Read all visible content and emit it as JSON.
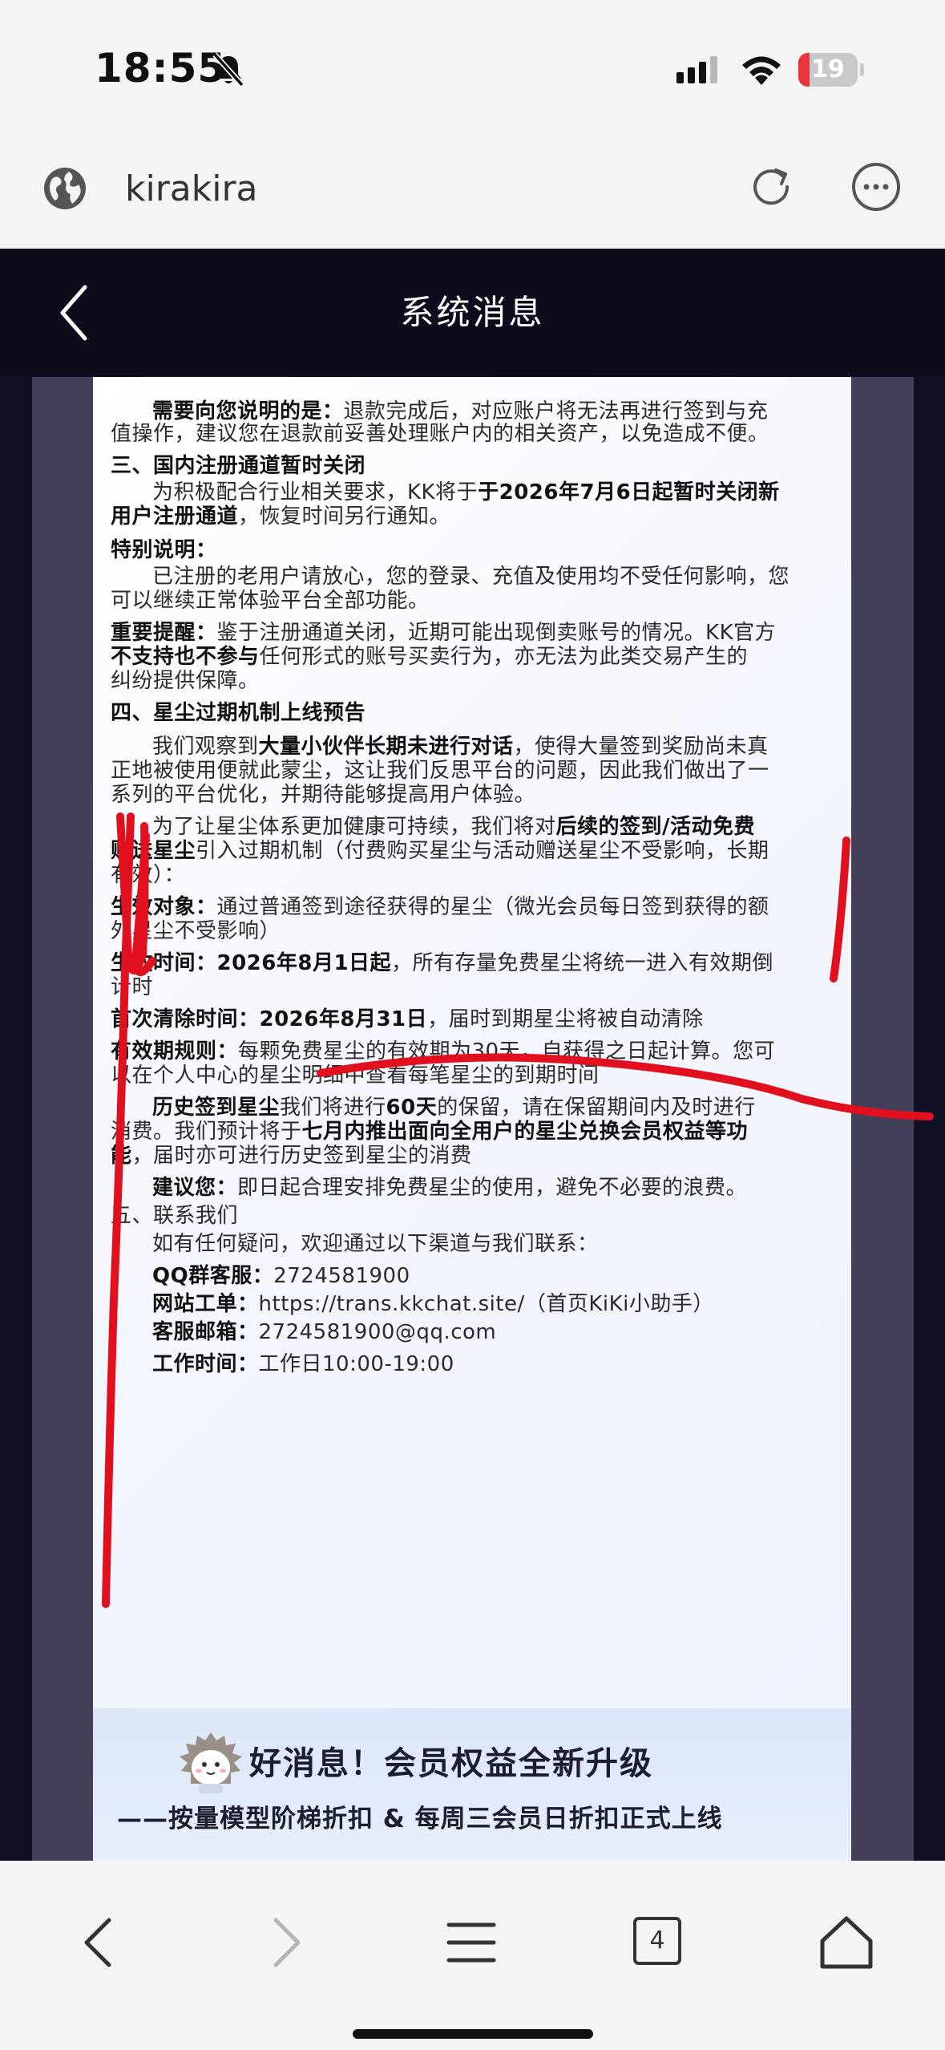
{
  "status_bar": {
    "time": "18:55",
    "battery_level": "19"
  },
  "browser": {
    "site_title": "kirakira",
    "tab_count": "4"
  },
  "app_header": {
    "title": "系统消息"
  },
  "notice": {
    "lines": [
      {
        "segments": [
          {
            "t": "需要向您说明的是：",
            "b": true
          },
          {
            "t": "退款完成后，对应账户将无法再进行签到与充"
          }
        ]
      },
      {
        "segments": [
          {
            "t": "值操作，建议您在退款前妥善处理账户内的相关资产，以免造成不便。"
          }
        ]
      },
      {
        "segments": [
          {
            "t": "三、国内注册通道暂时关闭",
            "b": true
          }
        ]
      },
      {
        "segments": [
          {
            "t": "为积极配合行业相关要求，KK将于"
          },
          {
            "t": "于2026年7月6日起暂时关闭新",
            "b": true
          }
        ]
      },
      {
        "segments": [
          {
            "t": "用户注册通道",
            "b": true
          },
          {
            "t": "，恢复时间另行通知。"
          }
        ]
      },
      {
        "segments": [
          {
            "t": "特别说明：",
            "b": true
          }
        ]
      },
      {
        "segments": [
          {
            "t": "已注册的老用户请放心，您的登录、充值及使用均不受任何影响，您"
          }
        ]
      },
      {
        "segments": [
          {
            "t": "可以继续正常体验平台全部功能。"
          }
        ]
      },
      {
        "segments": [
          {
            "t": "重要提醒：",
            "b": true
          },
          {
            "t": "鉴于注册通道关闭，近期可能出现倒卖账号的情况。KK官方"
          }
        ]
      },
      {
        "segments": [
          {
            "t": "不支持也不参与",
            "b": true
          },
          {
            "t": "任何形式的账号买卖行为，亦无法为此类交易产生的"
          }
        ]
      },
      {
        "segments": [
          {
            "t": "纠纷提供保障。"
          }
        ]
      },
      {
        "segments": [
          {
            "t": "四、星尘过期机制上线预告",
            "b": true
          }
        ]
      },
      {
        "segments": [
          {
            "t": "我们观察到"
          },
          {
            "t": "大量小伙伴长期未进行对话",
            "b": true
          },
          {
            "t": "，使得大量签到奖励尚未真"
          }
        ]
      },
      {
        "segments": [
          {
            "t": "正地被使用便就此蒙尘，这让我们反思平台的问题，因此我们做出了一"
          }
        ]
      },
      {
        "segments": [
          {
            "t": "系列的平台优化，并期待能够提高用户体验。"
          }
        ]
      },
      {
        "segments": [
          {
            "t": "为了让星尘体系更加健康可持续，我们将对"
          },
          {
            "t": "后续的签到/活动免费",
            "b": true
          }
        ]
      },
      {
        "segments": [
          {
            "t": "赠送星尘",
            "b": true
          },
          {
            "t": "引入过期机制（付费购买星尘与活动赠送星尘不受影响，长期"
          }
        ]
      },
      {
        "segments": [
          {
            "t": "有效）："
          }
        ]
      },
      {
        "segments": [
          {
            "t": "生效对象：",
            "b": true
          },
          {
            "t": "通过普通签到途径获得的星尘（微光会员每日签到获得的额"
          }
        ]
      },
      {
        "segments": [
          {
            "t": "外星尘不受影响）"
          }
        ]
      },
      {
        "segments": [
          {
            "t": "生效时间：2026年8月1日起",
            "b": true
          },
          {
            "t": "，所有存量免费星尘将统一进入有效期倒"
          }
        ]
      },
      {
        "segments": [
          {
            "t": "计时"
          }
        ]
      },
      {
        "segments": [
          {
            "t": "首次清除时间：2026年8月31日",
            "b": true
          },
          {
            "t": "，届时到期星尘将被自动清除"
          }
        ]
      },
      {
        "segments": [
          {
            "t": "有效期规则：",
            "b": true
          },
          {
            "t": "每颗免费星尘的有效期为30天，自获得之日起计算。您可"
          }
        ]
      },
      {
        "segments": [
          {
            "t": "以在个人中心的星尘明细中查看每笔星尘的到期时间"
          }
        ]
      },
      {
        "segments": [
          {
            "t": "历史签到星尘",
            "b": true
          },
          {
            "t": "我们将进行"
          },
          {
            "t": "60天",
            "b": true
          },
          {
            "t": "的保留，请在保留期间内及时进行"
          }
        ]
      },
      {
        "segments": [
          {
            "t": "消费。我们预计将于"
          },
          {
            "t": "七月内推出面向全用户的星尘兑换会员权益等功",
            "b": true
          }
        ]
      },
      {
        "segments": [
          {
            "t": "能",
            "b": true
          },
          {
            "t": "，届时亦可进行历史签到星尘的消费"
          }
        ]
      },
      {
        "segments": [
          {
            "t": "建议您：",
            "b": true
          },
          {
            "t": "即日起合理安排免费星尘的使用，避免不必要的浪费。"
          }
        ]
      },
      {
        "segments": [
          {
            "t": "五、联系我们"
          }
        ]
      },
      {
        "segments": [
          {
            "t": "如有任何疑问，欢迎通过以下渠道与我们联系："
          }
        ]
      },
      {
        "segments": [
          {
            "t": "QQ群客服：",
            "b": true
          },
          {
            "t": "2724581900"
          }
        ]
      },
      {
        "segments": [
          {
            "t": "网站工单：",
            "b": true
          },
          {
            "t": "https://trans.kkchat.site/（首页KiKi小助手）"
          }
        ]
      },
      {
        "segments": [
          {
            "t": "客服邮箱：",
            "b": true
          },
          {
            "t": "2724581900@qq.com"
          }
        ]
      },
      {
        "segments": [
          {
            "t": "工作时间：",
            "b": true
          },
          {
            "t": "工作日10:00-19:00"
          }
        ]
      }
    ]
  },
  "promo": {
    "title": "好消息！会员权益全新升级",
    "subtitle": "——按量模型阶梯折扣 & 每周三会员日折扣正式上线"
  },
  "colors": {
    "header_bg": "#0d0c1d",
    "annotation_red": "#e0101e",
    "battery_red": "#e8343a"
  }
}
